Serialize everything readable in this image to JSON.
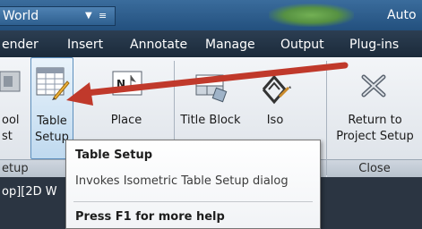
{
  "titlebar": {
    "workspace": "World",
    "workspace_arrow": "▼",
    "menu_glyph": "≡",
    "app_title": "Auto"
  },
  "tabs": [
    "ender",
    "Insert",
    "Annotate",
    "Manage",
    "Output",
    "Plug-ins"
  ],
  "ribbon": {
    "left_tool": {
      "line1": "ool",
      "line2": "st"
    },
    "table_setup": {
      "line1": "Table",
      "line2": "Setup"
    },
    "place": {
      "label": "Place",
      "icon_letter": "N"
    },
    "title_block": {
      "label": "Title Block"
    },
    "iso": {
      "label": "Iso"
    },
    "return": {
      "line1": "Return to",
      "line2": "Project Setup"
    },
    "groups": {
      "setup": "etup",
      "close": "Close"
    }
  },
  "document_label": "op][2D W",
  "tooltip": {
    "title": "Table Setup",
    "description": "Invokes Isometric Table Setup dialog",
    "help": "Press F1 for more help"
  },
  "colors": {
    "annotation_arrow": "#c0392b",
    "hover_highlight": "#bfd9ef",
    "tab_bar": "#1f2f40"
  }
}
